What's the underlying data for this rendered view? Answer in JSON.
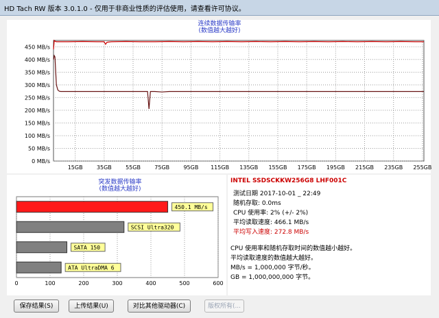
{
  "window": {
    "title": "HD Tach RW 版本 3.0.1.0  - 仅用于非商业性质的评估使用，请查看许可协议。"
  },
  "read_chart": {
    "title_line1": "连续数据传输率",
    "title_line2": "(数值越大越好)"
  },
  "burst_chart": {
    "title_line1": "突发数据传输率",
    "title_line2": "(数值越大越好)"
  },
  "info": {
    "drive_name": "INTEL SSDSCKKW256G8 LHF001C",
    "test_date": "测试日期 2017-10-01 _ 22:49",
    "random_access": "随机存取: 0.0ms",
    "cpu_usage": "CPU 使用率: 2% (+/- 2%)",
    "avg_read": "平均读取速度: 466.1 MB/s",
    "avg_write": "平均写入速度: 272.8 MB/s",
    "note1": "CPU 使用率和随机存取时间的数值越小越好。",
    "note2": "平均读取速度的数值越大越好。",
    "note3": "MB/s = 1,000,000 字节/秒。",
    "note4": "GB = 1,000,000,000 字节。"
  },
  "buttons": {
    "save": "保存结果(S)",
    "upload": "上传结果(U)",
    "compare": "对比其他驱动器(C)",
    "copyright": "版权所有(..."
  },
  "colors": {
    "read_line": "#cc0000",
    "write_line": "#661111",
    "hd_bar": "#ff1a1a",
    "grey_bar": "#808080",
    "tag_bg": "#ffff99",
    "chart_title": "#2c3cc7",
    "drive_name": "#cc0000",
    "avg_write": "#cc0000"
  },
  "chart_data": [
    {
      "type": "line",
      "x_ticks": [
        "15GB",
        "35GB",
        "55GB",
        "75GB",
        "95GB",
        "115GB",
        "135GB",
        "155GB",
        "175GB",
        "195GB",
        "215GB",
        "235GB",
        "255GB"
      ],
      "y_ticks": [
        "450 MB/s",
        "400 MB/s",
        "350 MB/s",
        "300 MB/s",
        "250 MB/s",
        "200 MB/s",
        "150 MB/s",
        "100 MB/s",
        "50 MB/s",
        "0 MB/s"
      ],
      "xlim": [
        0,
        256
      ],
      "ylim": [
        0,
        475
      ],
      "grid": true,
      "series": [
        {
          "role": "read",
          "x": [
            0,
            0.5,
            1,
            2,
            3,
            5,
            10,
            20,
            30,
            35,
            36,
            37,
            40,
            50,
            60,
            70,
            80,
            90,
            100,
            110,
            120,
            130,
            140,
            150,
            160,
            170,
            180,
            190,
            200,
            210,
            220,
            230,
            240,
            250,
            256
          ],
          "y": [
            440,
            475,
            472,
            470,
            470,
            470,
            470,
            471,
            470,
            470,
            460,
            468,
            470,
            471,
            470,
            470,
            471,
            470,
            471,
            470,
            471,
            470,
            471,
            470,
            471,
            470,
            471,
            470,
            471,
            470,
            471,
            470,
            471,
            470,
            470
          ]
        },
        {
          "role": "write",
          "x": [
            0,
            0.5,
            1,
            2,
            3,
            4,
            5,
            10,
            20,
            30,
            40,
            50,
            60,
            65,
            66,
            67,
            70,
            75,
            80,
            90,
            100,
            110,
            120,
            130,
            140,
            150,
            160,
            170,
            180,
            190,
            200,
            210,
            220,
            230,
            240,
            250,
            256
          ],
          "y": [
            400,
            415,
            410,
            300,
            280,
            275,
            274,
            274,
            274,
            274,
            274,
            274,
            274,
            274,
            205,
            274,
            274,
            272,
            274,
            274,
            274,
            274,
            274,
            274,
            274,
            274,
            274,
            274,
            274,
            274,
            274,
            274,
            274,
            274,
            274,
            274,
            274
          ]
        }
      ]
    },
    {
      "type": "bar",
      "orientation": "horizontal",
      "categories": [
        "450.1 MB/s",
        "SCSI Ultra320",
        "SATA 150",
        "ATA UltraDMA 6"
      ],
      "values": [
        450.1,
        320,
        150,
        133
      ],
      "x_ticks": [
        "0",
        "100",
        "200",
        "300",
        "400",
        "500",
        "600"
      ],
      "xlim": [
        0,
        600
      ],
      "grid": true
    }
  ]
}
